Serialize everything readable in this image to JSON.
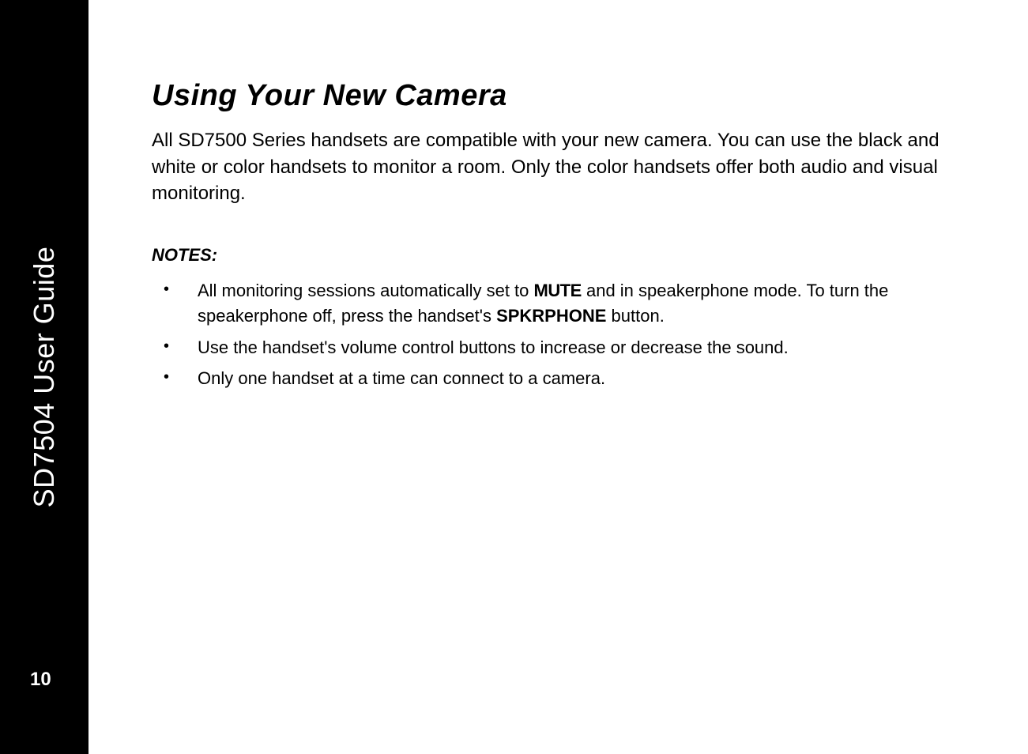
{
  "sidebar": {
    "title": "SD7504 User Guide",
    "page_number": "10"
  },
  "main": {
    "heading": "Using Your New Camera",
    "intro": "All SD7500 Series handsets are compatible with your new camera. You can use the black and white or color handsets to monitor a room. Only the color handsets offer both audio and visual monitoring.",
    "notes_label": "NOTES:",
    "notes": [
      {
        "pre": "All monitoring sessions automatically set to ",
        "mute": "MUTE",
        "mid": " and in speakerphone mode. To turn the speakerphone off, press the handset's ",
        "bold": "SPKRPHONE",
        "post": " button."
      },
      {
        "text": "Use the handset's volume control buttons to increase or decrease the sound."
      },
      {
        "text": "Only one handset at a time can connect to a camera."
      }
    ]
  }
}
